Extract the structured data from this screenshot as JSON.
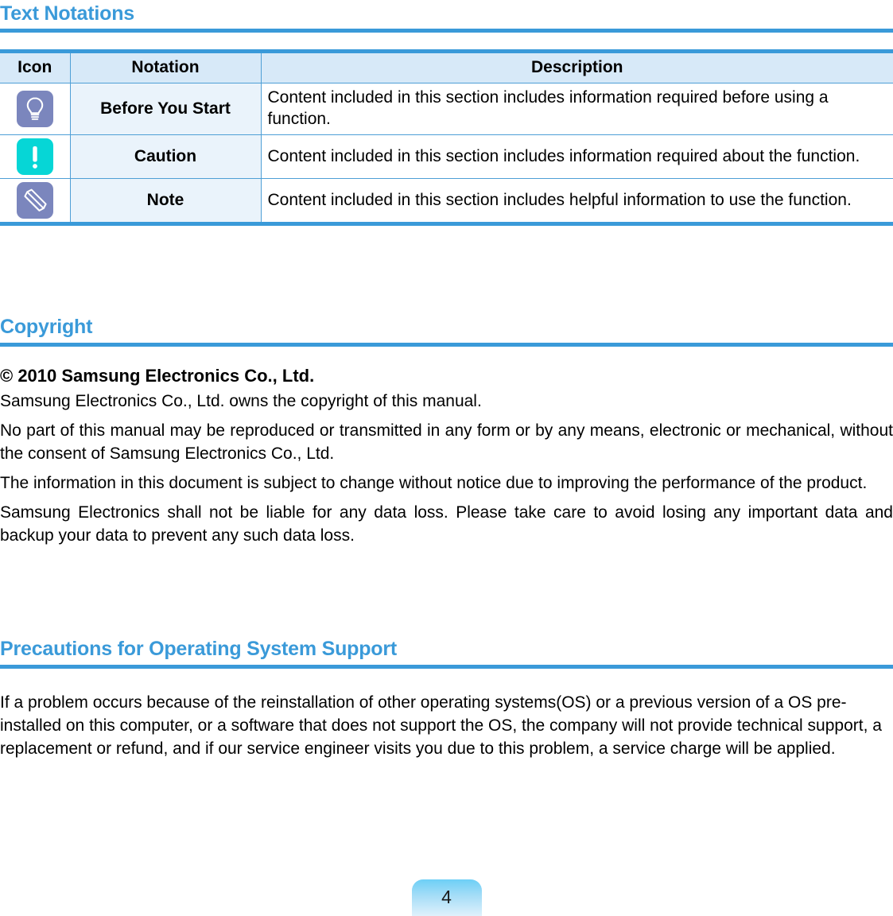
{
  "document": {
    "page_number": "4",
    "accent_color": "#3a9ad9",
    "rule_color": "#3a9ad9",
    "table_border_color": "#4e9fd6",
    "table_header_bg": "#d7e9f8",
    "notation_cell_bg": "#eaf3fb"
  },
  "sections": {
    "text_notations": {
      "heading": "Text Notations",
      "table": {
        "columns": [
          "Icon",
          "Notation",
          "Description"
        ],
        "rows": [
          {
            "icon_name": "lightbulb-icon",
            "icon_color": "#7b86bd",
            "notation": "Before You Start",
            "description": "Content included in this section includes information required before using a function."
          },
          {
            "icon_name": "exclamation-icon",
            "icon_color": "#06d6d6",
            "notation": "Caution",
            "description": "Content included in this section includes information required about the function."
          },
          {
            "icon_name": "pencil-icon",
            "icon_color": "#7b86bd",
            "notation": "Note",
            "description": "Content included in this section includes helpful information to use the function."
          }
        ]
      }
    },
    "copyright": {
      "heading": "Copyright",
      "notice": "© 2010 Samsung Electronics Co., Ltd.",
      "paragraphs": [
        "Samsung Electronics Co., Ltd. owns the copyright of this manual.",
        "No part of this manual may be reproduced or transmitted in any form or by any means, electronic or mechanical, without the consent of Samsung Electronics Co., Ltd.",
        "The information in this document is subject to change without notice due to improving the performance of the product.",
        "Samsung Electronics shall not be liable for any data loss. Please take care to avoid losing any important data and backup your data to prevent any such data loss."
      ]
    },
    "precautions": {
      "heading": "Precautions for Operating System Support",
      "paragraphs": [
        "If a problem occurs because of the reinstallation of other operating systems(OS) or a previous version of a OS pre-installed on this computer, or a software that does not support the OS, the company will not provide technical support, a replacement or refund, and if our service engineer visits you due to this problem, a service charge will be applied."
      ]
    }
  }
}
